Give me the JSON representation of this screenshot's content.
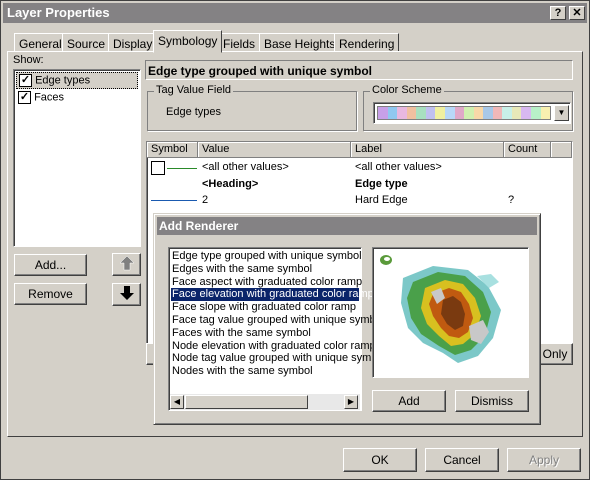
{
  "window": {
    "title": "Layer Properties",
    "help_btn": "?",
    "close_btn": "✕"
  },
  "tabs": [
    "General",
    "Source",
    "Display",
    "Symbology",
    "Fields",
    "Base Heights",
    "Rendering"
  ],
  "show": {
    "label": "Show:",
    "items": [
      {
        "label": "Edge types",
        "checked": true
      },
      {
        "label": "Faces",
        "checked": true
      }
    ],
    "add_button": "Add...",
    "remove_button": "Remove"
  },
  "renderer_heading": "Edge type grouped with unique symbol",
  "tag_value_field": {
    "label": "Tag Value Field",
    "value": "Edge types"
  },
  "color_scheme": {
    "label": "Color Scheme",
    "swatches": [
      "#c8a0e8",
      "#90c8f0",
      "#e8b8e0",
      "#f0c0a0",
      "#a8e0c0",
      "#c0c0f0",
      "#f0f0a0",
      "#b8d8f8",
      "#e0a8c8",
      "#d0f0b0",
      "#f8d8a8",
      "#a8c8e8",
      "#f0b8b8",
      "#c8f0e8",
      "#e8e8b8",
      "#d8b8f0",
      "#b8f0c8",
      "#f8f0b0"
    ]
  },
  "table": {
    "columns": [
      "Symbol",
      "Value",
      "Label",
      "Count"
    ],
    "rows": [
      {
        "value": "<all other values>",
        "label": "<all other values>",
        "count": "",
        "symbol": "box-line"
      },
      {
        "value": "<Heading>",
        "label": "Edge type",
        "count": "",
        "bold": true,
        "symbol": "none"
      },
      {
        "value": "2",
        "label": "Hard Edge",
        "count": "?",
        "symbol": "line"
      }
    ]
  },
  "only_button": "Only",
  "add_renderer": {
    "title": "Add Renderer",
    "items": [
      "Edge type grouped with unique symbol",
      "Edges with the same symbol",
      "Face aspect with graduated color ramp",
      "Face elevation with graduated color ramp",
      "Face slope with graduated color ramp",
      "Face tag value grouped with unique symbol",
      "Faces with the same symbol",
      "Node elevation with graduated color ramp",
      "Node tag value grouped with unique symbol",
      "Nodes with the same symbol"
    ],
    "selected_index": 3,
    "add_button": "Add",
    "dismiss_button": "Dismiss"
  },
  "footer": {
    "ok": "OK",
    "cancel": "Cancel",
    "apply": "Apply"
  }
}
